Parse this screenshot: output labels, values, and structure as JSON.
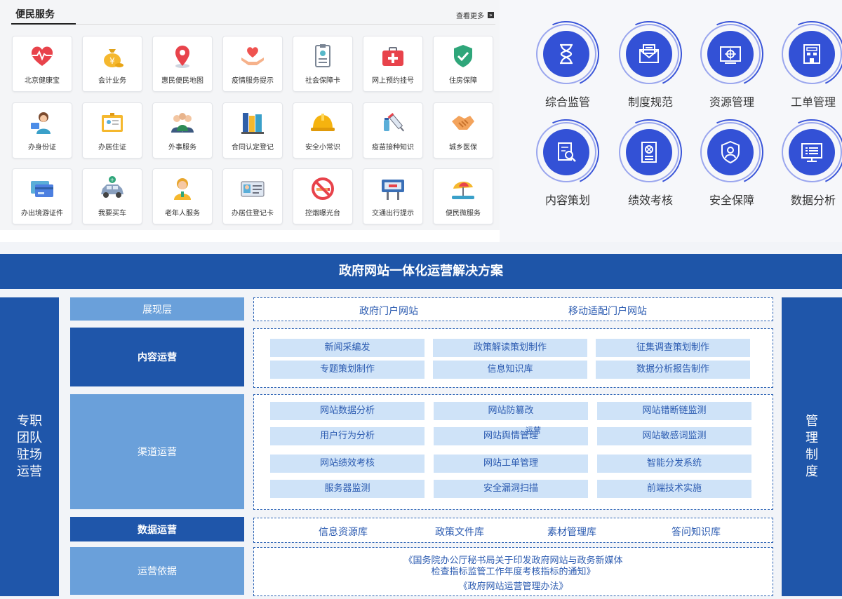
{
  "services": {
    "title": "便民服务",
    "more_label": "查看更多",
    "items": [
      {
        "label": "北京健康宝",
        "icon": "heart-pulse-icon"
      },
      {
        "label": "会计业务",
        "icon": "money-bag-icon"
      },
      {
        "label": "惠民便民地图",
        "icon": "map-pin-icon"
      },
      {
        "label": "疫情服务提示",
        "icon": "hands-heart-icon"
      },
      {
        "label": "社会保障卡",
        "icon": "id-badge-icon"
      },
      {
        "label": "网上预约挂号",
        "icon": "medical-kit-icon"
      },
      {
        "label": "住房保障",
        "icon": "shield-check-icon"
      },
      {
        "label": "办身份证",
        "icon": "person-id-card-icon"
      },
      {
        "label": "办居住证",
        "icon": "residence-card-icon"
      },
      {
        "label": "外事服务",
        "icon": "group-people-icon"
      },
      {
        "label": "合同认定登记",
        "icon": "binders-icon"
      },
      {
        "label": "安全小常识",
        "icon": "hard-hat-icon"
      },
      {
        "label": "疫苗接种知识",
        "icon": "vaccine-icon"
      },
      {
        "label": "城乡医保",
        "icon": "handshake-icon"
      },
      {
        "label": "办出境游证件",
        "icon": "travel-cards-icon"
      },
      {
        "label": "我要买车",
        "icon": "car-icon"
      },
      {
        "label": "老年人服务",
        "icon": "elderly-person-icon"
      },
      {
        "label": "办居住登记卡",
        "icon": "registration-card-icon"
      },
      {
        "label": "控烟曝光台",
        "icon": "no-smoking-icon"
      },
      {
        "label": "交通出行提示",
        "icon": "traffic-sign-icon"
      },
      {
        "label": "便民微服务",
        "icon": "beach-umbrella-icon"
      }
    ]
  },
  "features": [
    {
      "label": "综合监管",
      "icon": "hourglass-icon"
    },
    {
      "label": "制度规范",
      "icon": "envelope-icon"
    },
    {
      "label": "资源管理",
      "icon": "monitor-target-icon"
    },
    {
      "label": "工单管理",
      "icon": "building-icon"
    },
    {
      "label": "内容策划",
      "icon": "document-search-icon"
    },
    {
      "label": "绩效考核",
      "icon": "document-x-icon"
    },
    {
      "label": "安全保障",
      "icon": "shield-user-icon"
    },
    {
      "label": "数据分析",
      "icon": "desktop-list-icon"
    }
  ],
  "solution": {
    "title": "政府网站一体化运营解决方案",
    "left_pillar": "专职\n团队\n驻场\n运营",
    "right_pillar": "管\n理\n制\n度",
    "layers": [
      {
        "name": "展现层",
        "items": [
          "政府门户网站",
          "移动适配门户网站"
        ]
      },
      {
        "name": "内容运营",
        "items": [
          "新闻采编发",
          "政策解读策划制作",
          "征集调查策划制作",
          "专题策划制作",
          "信息知识库",
          "数据分析报告制作"
        ]
      },
      {
        "name": "渠道运营",
        "items": [
          "网站数据分析",
          "网站防篡改",
          "网站错断链监测",
          "用户行为分析",
          "网站舆情管理",
          "网站敏感词监测",
          "网站绩效考核",
          "网站工单管理",
          "智能分发系统",
          "服务器监测",
          "安全漏洞扫描",
          "前端技术实施"
        ],
        "overlay_note": "运营"
      },
      {
        "name": "数据运营",
        "items": [
          "信息资源库",
          "政策文件库",
          "素材管理库",
          "答问知识库"
        ]
      },
      {
        "name": "运营依据",
        "items": [
          "《国务院办公厅秘书局关于印发政府网站与政务新媒体",
          "检查指标监管工作年度考核指标的通知》",
          "《政府网站运营管理办法》"
        ]
      }
    ]
  },
  "colors": {
    "primary": "#1f56aa",
    "accent": "#3351d6",
    "light": "#6aa0da",
    "cell": "#cfe3f8"
  }
}
